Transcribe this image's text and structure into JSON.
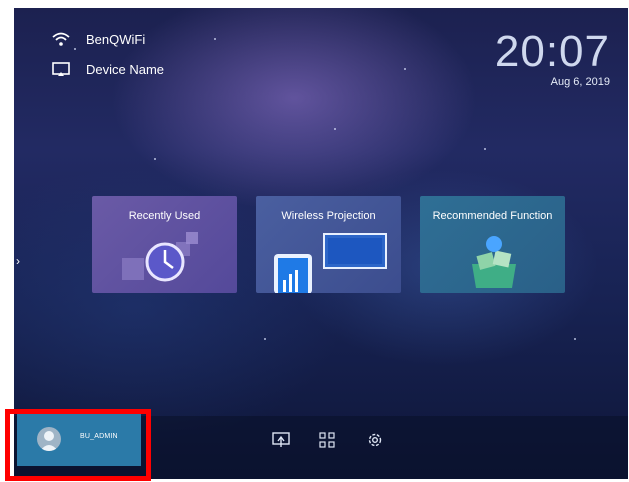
{
  "status": {
    "wifi_name": "BenQWiFi",
    "device_name": "Device Name"
  },
  "clock": {
    "time": "20:07",
    "date": "Aug 6, 2019"
  },
  "tiles": [
    {
      "label": "Recently Used",
      "icon": "clock-icon"
    },
    {
      "label": "Wireless Projection",
      "icon": "phone-screen-icon"
    },
    {
      "label": "Recommended Function",
      "icon": "gift-box-icon"
    }
  ],
  "user": {
    "name": "BU_ADMIN"
  },
  "bottom_icons": [
    "screen-mirror-icon",
    "apps-grid-icon",
    "settings-gear-icon"
  ],
  "colors": {
    "accent": "#2b7aa8",
    "highlight": "#ff0000"
  }
}
